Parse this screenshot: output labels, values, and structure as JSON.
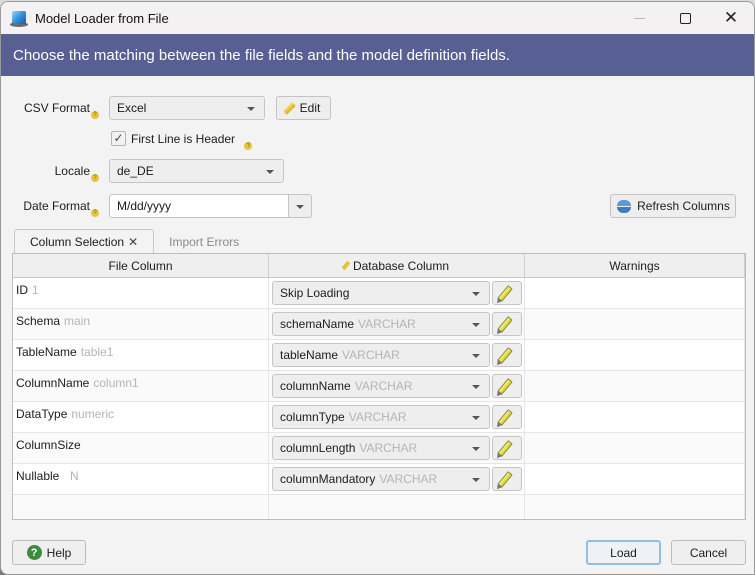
{
  "window": {
    "title": "Model Loader from File",
    "controls": {
      "minimize": "minimize",
      "maximize": "maximize",
      "close": "close"
    }
  },
  "banner": {
    "text": "Choose the matching between the file fields and the model definition fields."
  },
  "form": {
    "csv_format": {
      "label": "CSV Format",
      "value": "Excel",
      "edit_label": "Edit"
    },
    "first_line_header": {
      "label": "First Line is Header",
      "checked": true,
      "check_glyph": "✓"
    },
    "locale": {
      "label": "Locale",
      "value": "de_DE"
    },
    "date_format": {
      "label": "Date Format",
      "value": "M/dd/yyyy"
    },
    "refresh_label": "Refresh Columns",
    "help_glyph": "?"
  },
  "tabs": [
    {
      "label": "Column Selection",
      "active": true,
      "close_glyph": "✕"
    },
    {
      "label": "Import Errors",
      "active": false
    }
  ],
  "grid": {
    "headers": {
      "file_column": "File Column",
      "database_column": "Database Column",
      "warnings": "Warnings"
    },
    "rows": [
      {
        "file_field": "ID",
        "sample": "1",
        "db_column": "Skip Loading",
        "db_type": "",
        "warning": ""
      },
      {
        "file_field": "Schema",
        "sample": "main",
        "db_column": "schemaName",
        "db_type": "VARCHAR",
        "warning": ""
      },
      {
        "file_field": "TableName",
        "sample": "table1",
        "db_column": "tableName",
        "db_type": "VARCHAR",
        "warning": ""
      },
      {
        "file_field": "ColumnName",
        "sample": "column1",
        "db_column": "columnName",
        "db_type": "VARCHAR",
        "warning": ""
      },
      {
        "file_field": "DataType",
        "sample": "numeric",
        "db_column": "columnType",
        "db_type": "VARCHAR",
        "warning": ""
      },
      {
        "file_field": "ColumnSize",
        "sample": "",
        "db_column": "columnLength",
        "db_type": "VARCHAR",
        "warning": ""
      },
      {
        "file_field": "Nullable",
        "sample": "  N",
        "db_column": "columnMandatory",
        "db_type": "VARCHAR",
        "warning": ""
      }
    ]
  },
  "footer": {
    "help_label": "Help",
    "help_icon": "?",
    "load_label": "Load",
    "cancel_label": "Cancel"
  },
  "colors": {
    "banner": "#585f92",
    "help_icon": "#3e8a3e",
    "hint_icon": "#e8c23a",
    "default_button_border": "#8fc0e4"
  }
}
